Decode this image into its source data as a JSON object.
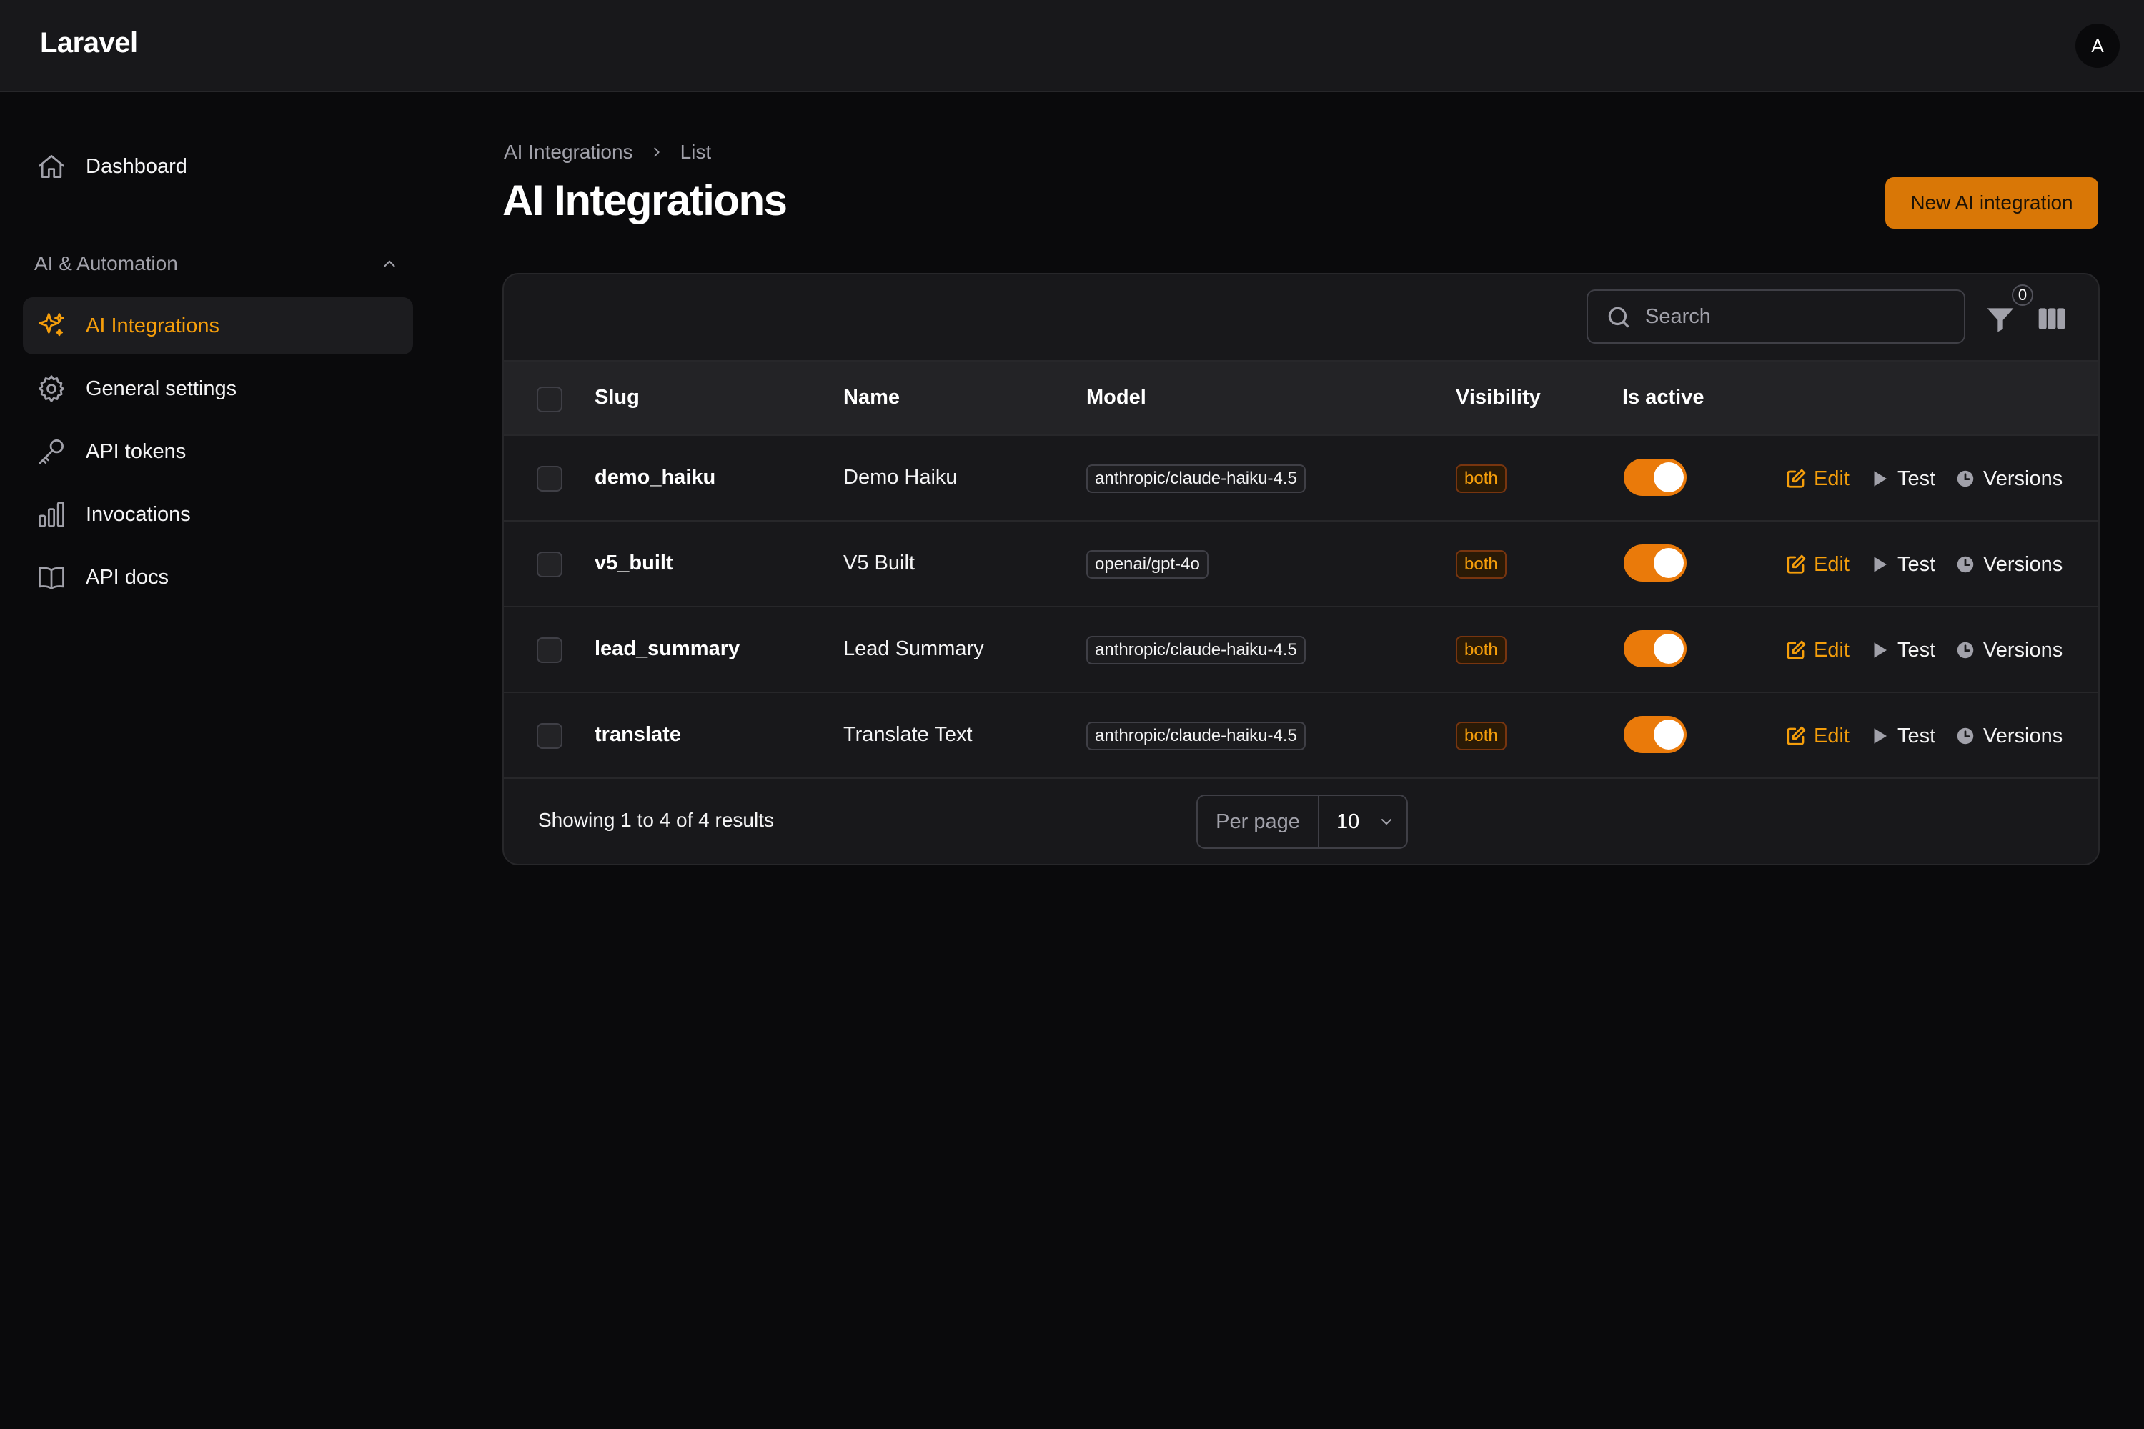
{
  "app": {
    "brand": "Laravel",
    "avatar_initial": "A"
  },
  "sidebar": {
    "dashboard": "Dashboard",
    "group_label": "AI & Automation",
    "items": [
      {
        "label": "AI Integrations",
        "icon": "sparkles-icon",
        "active": true
      },
      {
        "label": "General settings",
        "icon": "gear-icon"
      },
      {
        "label": "API tokens",
        "icon": "key-icon"
      },
      {
        "label": "Invocations",
        "icon": "bar-chart-icon"
      },
      {
        "label": "API docs",
        "icon": "book-icon"
      }
    ]
  },
  "breadcrumb": {
    "root": "AI Integrations",
    "current": "List"
  },
  "page": {
    "title": "AI Integrations",
    "new_button": "New AI integration"
  },
  "table": {
    "search_placeholder": "Search",
    "filter_count": "0",
    "columns": [
      "Slug",
      "Name",
      "Model",
      "Visibility",
      "Is active"
    ],
    "rows": [
      {
        "slug": "demo_haiku",
        "name": "Demo Haiku",
        "model": "anthropic/claude-haiku-4.5",
        "visibility": "both",
        "active": true
      },
      {
        "slug": "v5_built",
        "name": "V5 Built",
        "model": "openai/gpt-4o",
        "visibility": "both",
        "active": true
      },
      {
        "slug": "lead_summary",
        "name": "Lead Summary",
        "model": "anthropic/claude-haiku-4.5",
        "visibility": "both",
        "active": true
      },
      {
        "slug": "translate",
        "name": "Translate Text",
        "model": "anthropic/claude-haiku-4.5",
        "visibility": "both",
        "active": true
      }
    ],
    "actions": {
      "edit": "Edit",
      "test": "Test",
      "versions": "Versions"
    },
    "footer": {
      "results": "Showing 1 to 4 of 4 results",
      "per_page_label": "Per page",
      "per_page_value": "10"
    }
  },
  "colors": {
    "accent": "#f59e0b",
    "primary_button": "#d97706",
    "toggle_on": "#ea7a0a"
  }
}
